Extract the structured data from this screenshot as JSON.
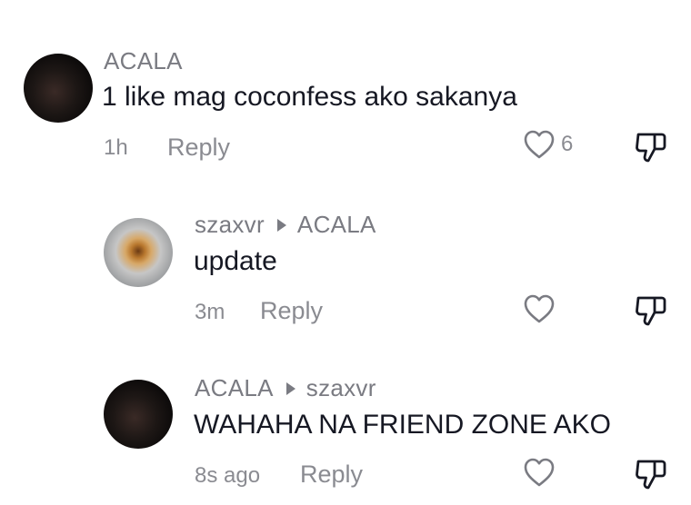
{
  "comments": [
    {
      "username": "ACALA",
      "reply_to": "",
      "text": "1 like mag coconfess ako sakanya",
      "time": "1h",
      "reply_label": "Reply",
      "like_count": "6"
    },
    {
      "username": "szaxvr",
      "reply_to": "ACALA",
      "text": "update",
      "time": "3m",
      "reply_label": "Reply",
      "like_count": ""
    },
    {
      "username": "ACALA",
      "reply_to": "szaxvr",
      "text": "WAHAHA NA FRIEND ZONE AKO",
      "time": "8s ago",
      "reply_label": "Reply",
      "like_count": ""
    }
  ],
  "icons": {
    "like": "heart-outline-icon",
    "dislike": "thumbs-down-icon",
    "reply_arrow": "right-triangle-icon"
  },
  "colors": {
    "text": "#161823",
    "secondary": "#8a8b91"
  }
}
